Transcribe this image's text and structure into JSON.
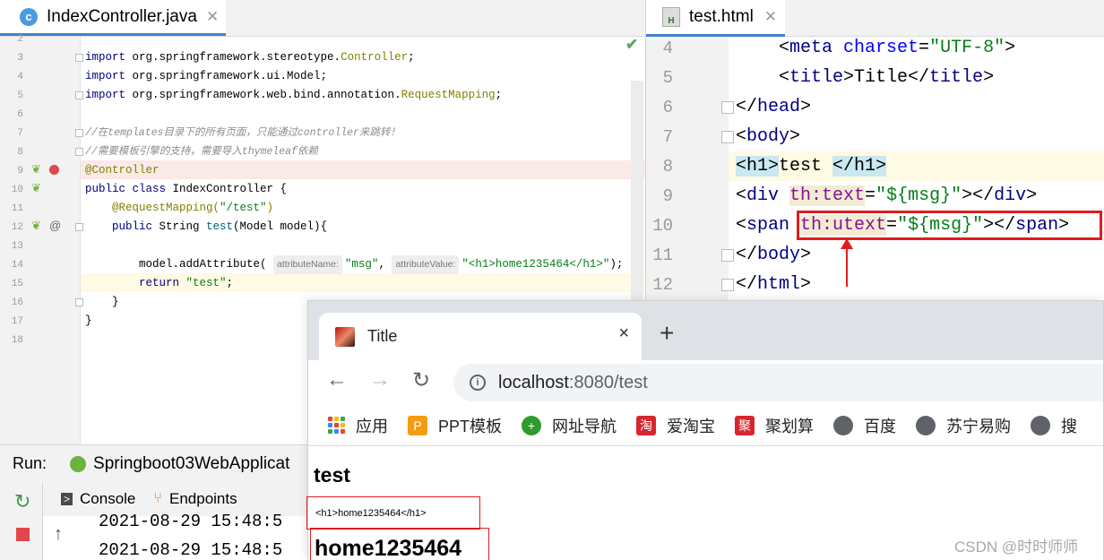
{
  "left_editor": {
    "tab_title": "IndexController.java",
    "tab_icon_letter": "c",
    "line_numbers": [
      "2",
      "3",
      "4",
      "5",
      "6",
      "7",
      "8",
      "9",
      "10",
      "11",
      "12",
      "13",
      "14",
      "15",
      "16",
      "17",
      "18"
    ],
    "lines": {
      "l3a": "import ",
      "l3b": "org.springframework.stereotype.",
      "l3c": "Controller",
      "l3d": ";",
      "l4a": "import ",
      "l4b": "org.springframework.ui.Model;",
      "l5a": "import ",
      "l5b": "org.springframework.web.bind.annotation.",
      "l5c": "RequestMapping",
      "l5d": ";",
      "l7": "//在templates目录下的所有页面，只能通过controller来跳转！",
      "l8": "//需要模板引擎的支持，需要导入thymeleaf依赖",
      "l9": "@Controller",
      "l10a": "public class ",
      "l10b": "IndexController {",
      "l11a": "    @RequestMapping(",
      "l11b": "\"/test\"",
      "l11c": ")",
      "l12a": "    public ",
      "l12b": "String ",
      "l12c": "test",
      "l12d": "(Model model){",
      "l14a": "        model.addAttribute( ",
      "l14_hint1": "attributeName:",
      "l14b": "\"msg\"",
      "l14c": ", ",
      "l14_hint2": "attributeValue:",
      "l14d": "\"<h1>home1235464</h1>\"",
      "l14e": ");",
      "l15a": "        return ",
      "l15b": "\"test\"",
      "l15c": ";",
      "l16": "    }",
      "l17": "}"
    }
  },
  "run_panel": {
    "label": "Run:",
    "config_name": "Springboot03WebApplicat",
    "tabs": [
      "Console",
      "Endpoints"
    ],
    "output": [
      "2021-08-29 15:48:5",
      "2021-08-29 15:48:5"
    ]
  },
  "right_editor": {
    "tab_title": "test.html",
    "line_numbers": [
      "4",
      "5",
      "6",
      "7",
      "8",
      "9",
      "10",
      "11",
      "12"
    ],
    "lines": {
      "r4a": "    <",
      "r4b": "meta ",
      "r4c": "charset",
      "r4d": "=",
      "r4e": "\"UTF-8\"",
      "r4f": ">",
      "r5a": "    <",
      "r5b": "title",
      "r5c": ">Title</",
      "r5d": "title",
      "r5e": ">",
      "r6a": "</",
      "r6b": "head",
      "r6c": ">",
      "r7a": "<",
      "r7b": "body",
      "r7c": ">",
      "r8a": "<h1>",
      "r8b": "test ",
      "r8c": "</h1>",
      "r9a": "<",
      "r9b": "div ",
      "r9c": "th:text",
      "r9d": "=",
      "r9e": "\"${msg}\"",
      "r9f": "></",
      "r9g": "div",
      "r9h": ">",
      "r10a": "<",
      "r10b": "span ",
      "r10c": "th:utext",
      "r10d": "=",
      "r10e": "\"${msg}\"",
      "r10f": "></",
      "r10g": "span",
      "r10h": ">",
      "r11a": "</",
      "r11b": "body",
      "r11c": ">",
      "r12a": "</",
      "r12b": "html",
      "r12c": ">"
    }
  },
  "browser": {
    "tab_title": "Title",
    "close_glyph": "×",
    "new_tab_glyph": "+",
    "url_host": "localhost",
    "url_path": ":8080/test",
    "bookmarks": [
      {
        "label": "应用",
        "icon": "apps-icon"
      },
      {
        "label": "PPT模板",
        "icon": "ppt-icon"
      },
      {
        "label": "网址导航",
        "icon": "nav-icon"
      },
      {
        "label": "爱淘宝",
        "icon": "taobao-icon"
      },
      {
        "label": "聚划算",
        "icon": "juhuasuan-icon"
      },
      {
        "label": "百度",
        "icon": "globe-icon"
      },
      {
        "label": "苏宁易购",
        "icon": "globe-icon"
      },
      {
        "label": "搜",
        "icon": "globe-icon"
      }
    ],
    "page": {
      "heading": "test",
      "escaped_text": "<h1>home1235464</h1>",
      "rendered_h1": "home1235464"
    }
  },
  "watermark": "CSDN @时时师师",
  "colors": {
    "accent": "#4083c9",
    "highlight_red": "#e11c1c",
    "keyword": "#000080",
    "string": "#067d17",
    "thymeleaf_attr": "#871094"
  }
}
